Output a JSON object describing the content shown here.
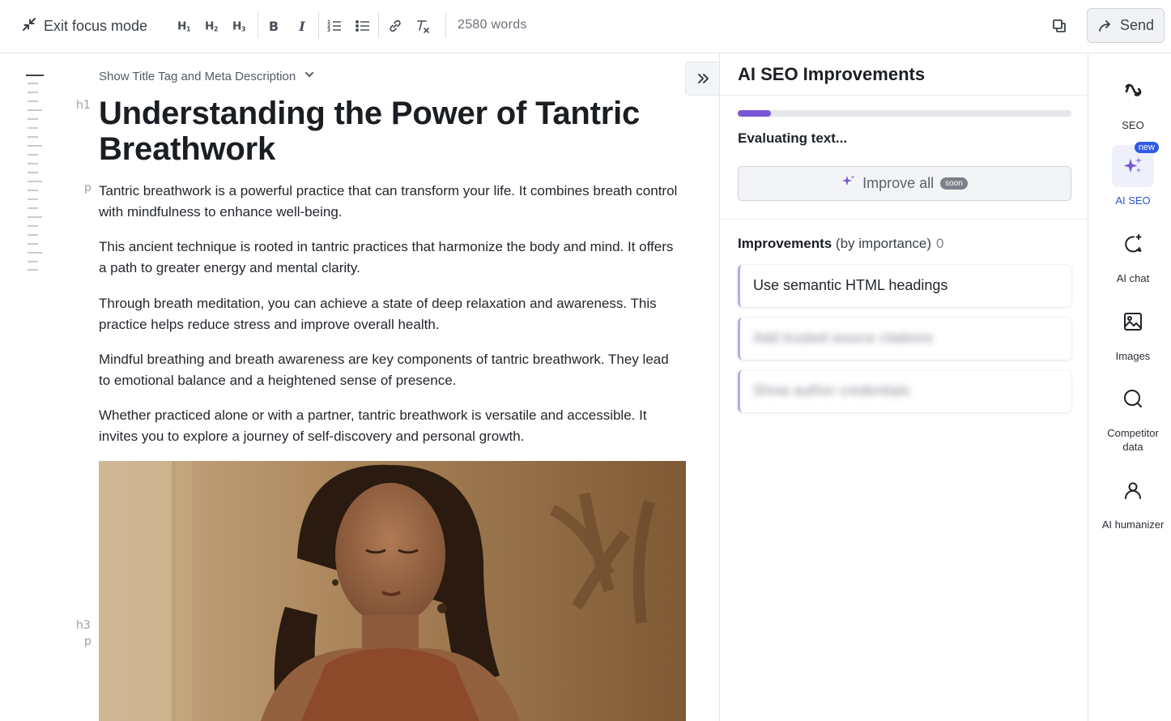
{
  "toolbar": {
    "exit_focus_label": "Exit focus mode",
    "h1_label": "H1",
    "h2_label": "H2",
    "h3_label": "H3",
    "bold_label": "B",
    "italic_label": "I",
    "word_count": "2580 words",
    "send_label": "Send"
  },
  "editor": {
    "meta_toggle_label": "Show Title Tag and Meta Description",
    "tags": {
      "h1": "h1",
      "p": "p",
      "h3": "h3"
    },
    "title": "Understanding the Power of Tantric Breathwork",
    "paragraphs": [
      "Tantric breathwork is a powerful practice that can transform your life. It combines breath control with mindfulness to enhance well-being.",
      "This ancient technique is rooted in tantric practices that harmonize the body and mind. It offers a path to greater energy and mental clarity.",
      "Through breath meditation, you can achieve a state of deep relaxation and awareness. This practice helps reduce stress and improve overall health.",
      "Mindful breathing and breath awareness are key components of tantric breathwork. They lead to emotional balance and a heightened sense of presence.",
      "Whether practiced alone or with a partner, tantric breathwork is versatile and accessible. It invites you to explore a journey of self-discovery and personal growth."
    ]
  },
  "panel": {
    "title": "AI SEO Improvements",
    "progress": 0.1,
    "status": "Evaluating text...",
    "improve_all_label": "Improve all",
    "soon_badge": "soon",
    "improvements_bold": "Improvements",
    "improvements_rest": " (by importance)",
    "improvements_count": "0",
    "items": [
      "Use semantic HTML headings",
      "Add trusted source citations",
      "Show author credentials"
    ]
  },
  "sidebar": {
    "items": [
      {
        "label": "SEO",
        "icon": "seo-icon"
      },
      {
        "label": "AI SEO",
        "icon": "sparkles-icon",
        "badge": "new"
      },
      {
        "label": "AI chat",
        "icon": "chat-icon"
      },
      {
        "label": "Images",
        "icon": "image-icon"
      },
      {
        "label": "Competitor data",
        "icon": "search-icon"
      },
      {
        "label": "AI humanizer",
        "icon": "user-icon"
      }
    ]
  },
  "colors": {
    "accent": "#7a56d6",
    "active_blue": "#2a55d8",
    "badge_blue": "#2f5be6"
  }
}
